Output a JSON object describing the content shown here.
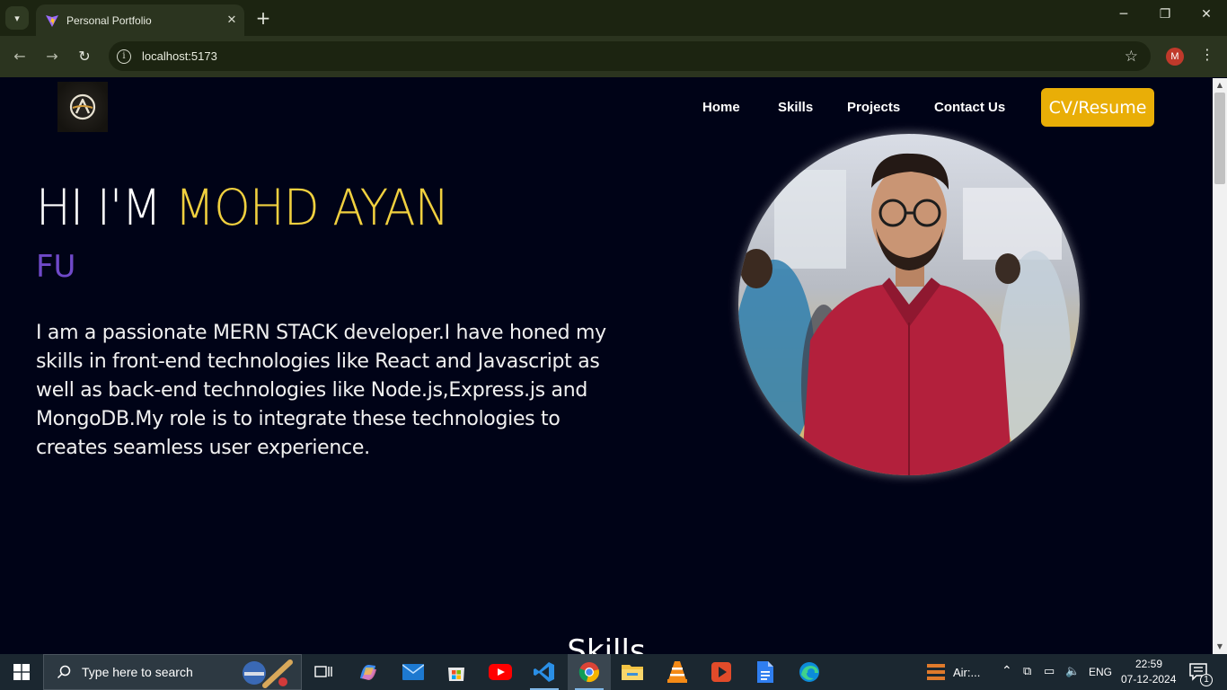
{
  "browser": {
    "tab_title": "Personal Portfolio",
    "url": "localhost:5173",
    "profile_initial": "M",
    "controls": {
      "minimize": "─",
      "restore": "❐",
      "close": "✕"
    }
  },
  "navbar": {
    "logo_alt": "A",
    "items": [
      "Home",
      "Skills",
      "Projects",
      "Contact Us"
    ],
    "cta_label": "CV/Resume"
  },
  "hero": {
    "greeting": "HI I'M ",
    "name": "MOHD AYAN",
    "typed_text": "FU",
    "description": "I am a passionate MERN STACK developer.I have honed my skills in front-end technologies like React and Javascript as well as back-end technologies like Node.js,Express.js and MongoDB.My role is to integrate these technologies to creates seamless user experience."
  },
  "sections": {
    "skills_heading": "Skills"
  },
  "taskbar": {
    "search_placeholder": "Type here to search",
    "tray_app_label": "Air:...",
    "language": "ENG",
    "time": "22:59",
    "date": "07-12-2024",
    "notification_count": "1"
  },
  "colors": {
    "page_bg": "#000317",
    "accent_yellow": "#f0d03f",
    "accent_purple": "#6f49c9",
    "cta_bg": "#e9ae07"
  }
}
